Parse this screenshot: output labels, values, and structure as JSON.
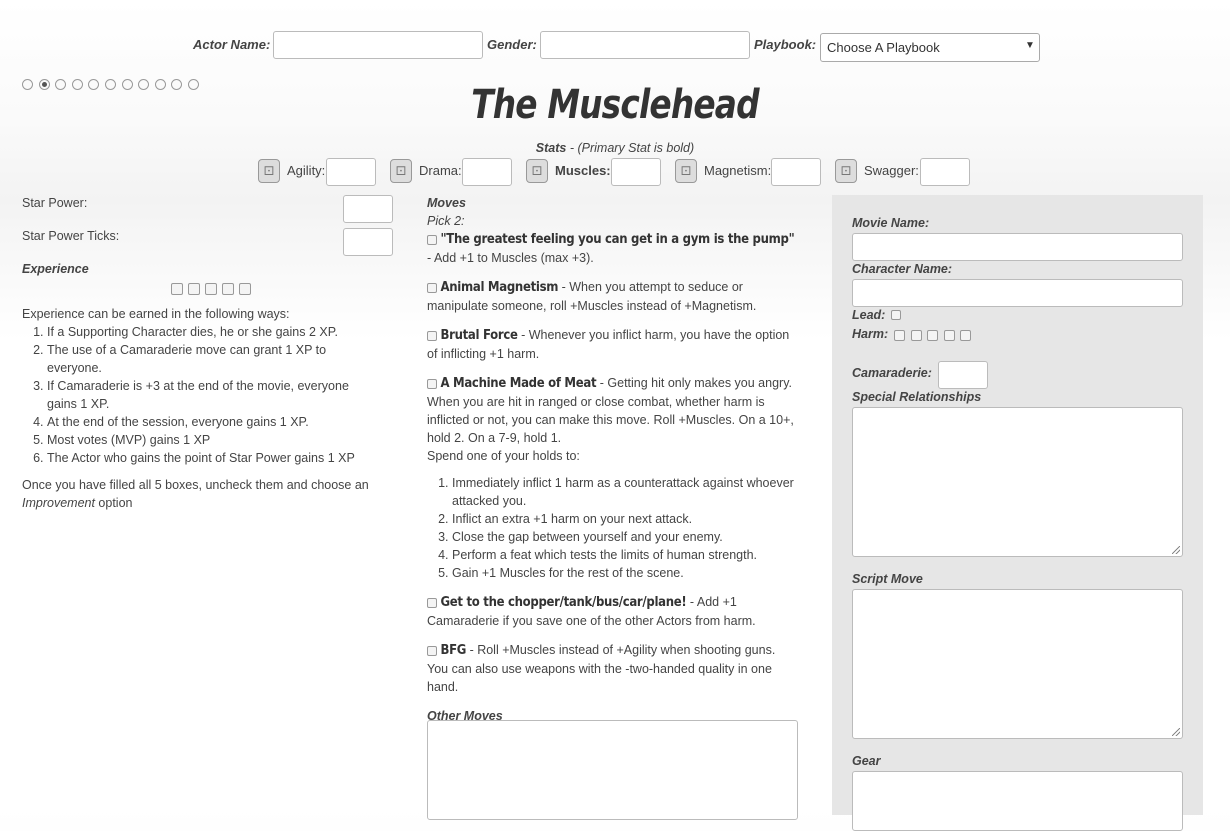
{
  "header": {
    "actor_name_label": "Actor Name:",
    "gender_label": "Gender:",
    "playbook_label": "Playbook:",
    "playbook_value": "Choose A Playbook",
    "page_indicator": {
      "count": 11,
      "selected": 2
    }
  },
  "title": "The Musclehead",
  "stats": {
    "caption_bold": "Stats",
    "caption_rest": " - (Primary Stat is bold)",
    "items": [
      {
        "label": "Agility:",
        "primary": false
      },
      {
        "label": "Drama:",
        "primary": false
      },
      {
        "label": "Muscles:",
        "primary": true
      },
      {
        "label": "Magnetism:",
        "primary": false
      },
      {
        "label": "Swagger:",
        "primary": false
      }
    ]
  },
  "left": {
    "star_power_label": "Star Power:",
    "star_power_ticks_label": "Star Power Ticks:",
    "experience_heading": "Experience",
    "xp_box_count": 5,
    "xp_intro": "Experience can be earned in the following ways:",
    "xp_ways": [
      "If a Supporting Character dies, he or she gains 2 XP.",
      "The use of a Camaraderie move can grant 1 XP to everyone.",
      "If Camaraderie is +3 at the end of the movie, everyone gains 1 XP.",
      "At the end of the session, everyone gains 1 XP.",
      "Most votes (MVP) gains 1 XP",
      "The Actor who gains the point of Star Power gains 1 XP"
    ],
    "xp_outro_before": "Once you have filled all 5 boxes, uncheck them and choose an ",
    "xp_outro_em": "Improvement",
    "xp_outro_after": " option"
  },
  "moves": {
    "heading": "Moves",
    "pick": "Pick 2:",
    "list": [
      {
        "name": "\"The greatest feeling you can get in a gym is the pump\"",
        "desc": " - Add +1 to Muscles (max +3)."
      },
      {
        "name": "Animal Magnetism",
        "desc": " - When you attempt to seduce or manipulate someone, roll +Muscles instead of +Magnetism."
      },
      {
        "name": "Brutal Force",
        "desc": " - Whenever you inflict harm, you have the option of inflicting +1 harm."
      },
      {
        "name": "A Machine Made of Meat",
        "desc": " - Getting hit only makes you angry. When you are hit in ranged or close combat, whether harm is inflicted or not, you can make this move. Roll +Muscles. On a 10+, hold 2. On a 7-9, hold 1."
      },
      {
        "name": "Get to the chopper/tank/bus/car/plane!",
        "desc": " - Add +1 Camaraderie if you save one of the other Actors from harm."
      },
      {
        "name": "BFG",
        "desc": " - Roll +Muscles instead of +Agility when shooting guns. You can also use weapons with the -two-handed quality in one hand."
      }
    ],
    "spend_intro": "Spend one of your holds to:",
    "spend_options": [
      "Immediately inflict 1 harm as a counterattack against whoever attacked you.",
      "Inflict an extra +1 harm on your next attack.",
      "Close the gap between yourself and your enemy.",
      "Perform a feat which tests the limits of human strength.",
      "Gain +1 Muscles for the rest of the scene."
    ],
    "other_moves_label": "Other Moves"
  },
  "panel": {
    "movie_name_label": "Movie Name:",
    "character_name_label": "Character Name:",
    "lead_label": "Lead:",
    "harm_label": "Harm:",
    "harm_box_count": 5,
    "camaraderie_label": "Camaraderie:",
    "special_relationships_label": "Special Relationships",
    "script_move_label": "Script Move",
    "gear_label": "Gear"
  }
}
